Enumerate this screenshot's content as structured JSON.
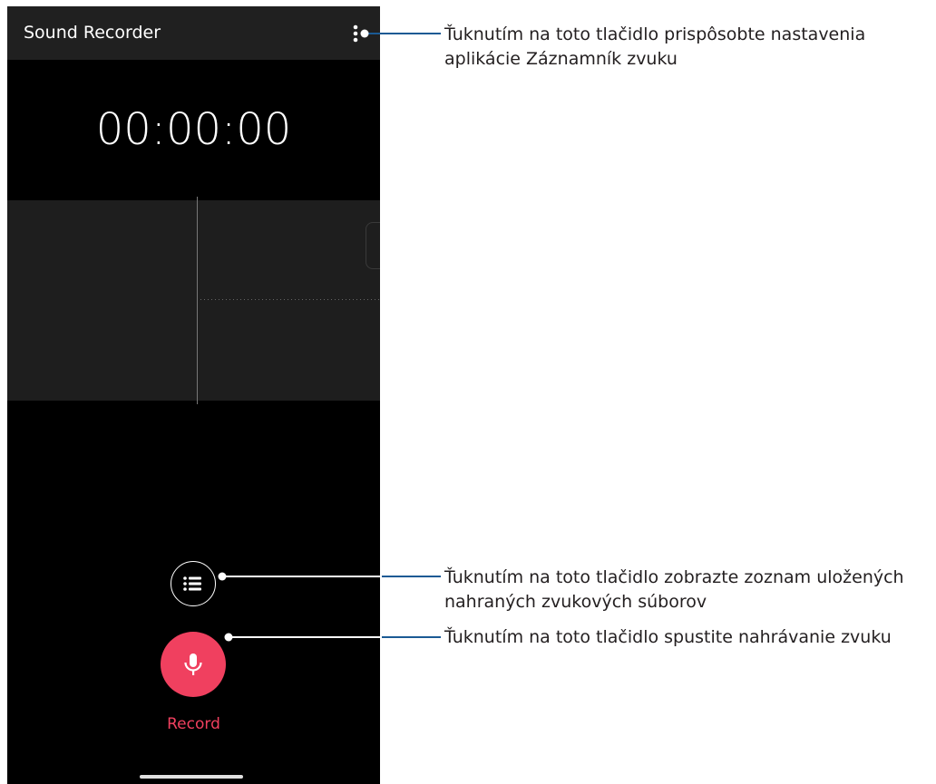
{
  "app": {
    "title": "Sound Recorder",
    "timer": "00:00:00",
    "record_label": "Record"
  },
  "icons": {
    "menu": "more-vert-icon",
    "list": "list-icon",
    "mic": "microphone-icon"
  },
  "colors": {
    "record_accent": "#f0405f",
    "callout_line": "#1b5a94"
  },
  "callouts": [
    {
      "line1": "Ťuknutím na toto tlačidlo prispôsobte nastavenia",
      "line2": "aplikácie Záznamník zvuku"
    },
    {
      "line1": "Ťuknutím na toto tlačidlo zobrazte zoznam uložených",
      "line2": "nahraných zvukových súborov"
    },
    {
      "line1": "Ťuknutím na toto tlačidlo spustite nahrávanie zvuku",
      "line2": ""
    }
  ]
}
